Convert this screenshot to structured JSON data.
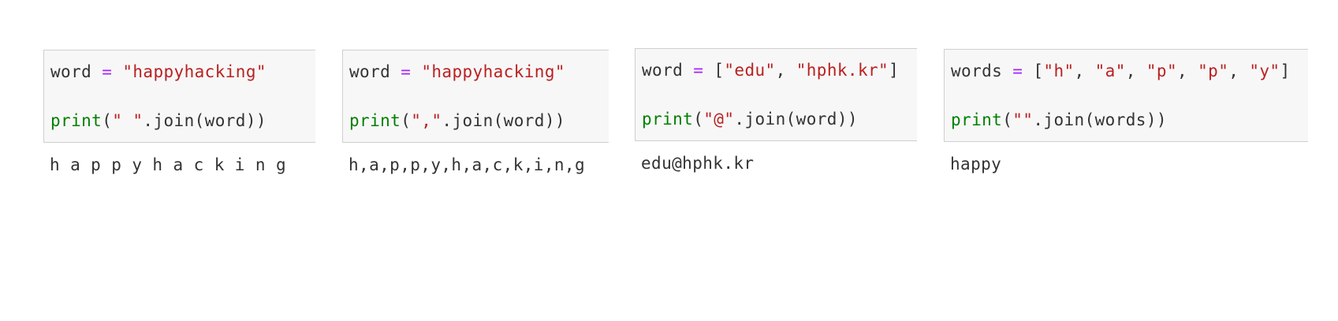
{
  "cells": [
    {
      "line1": [
        {
          "t": "word",
          "k": "name"
        },
        {
          "t": " ",
          "k": "punc"
        },
        {
          "t": "=",
          "k": "op"
        },
        {
          "t": " ",
          "k": "punc"
        },
        {
          "t": "\"happyhacking\"",
          "k": "str"
        }
      ],
      "line2": [
        {
          "t": "print",
          "k": "builtin"
        },
        {
          "t": "(",
          "k": "punc"
        },
        {
          "t": "\" \"",
          "k": "str"
        },
        {
          "t": ".join(word))",
          "k": "punc"
        }
      ],
      "output": "h a p p y h a c k i n g"
    },
    {
      "line1": [
        {
          "t": "word",
          "k": "name"
        },
        {
          "t": " ",
          "k": "punc"
        },
        {
          "t": "=",
          "k": "op"
        },
        {
          "t": " ",
          "k": "punc"
        },
        {
          "t": "\"happyhacking\"",
          "k": "str"
        }
      ],
      "line2": [
        {
          "t": "print",
          "k": "builtin"
        },
        {
          "t": "(",
          "k": "punc"
        },
        {
          "t": "\",\"",
          "k": "str"
        },
        {
          "t": ".join(word))",
          "k": "punc"
        }
      ],
      "output": "h,a,p,p,y,h,a,c,k,i,n,g"
    },
    {
      "line1": [
        {
          "t": "word",
          "k": "name"
        },
        {
          "t": " ",
          "k": "punc"
        },
        {
          "t": "=",
          "k": "op"
        },
        {
          "t": " [",
          "k": "punc"
        },
        {
          "t": "\"edu\"",
          "k": "str"
        },
        {
          "t": ", ",
          "k": "punc"
        },
        {
          "t": "\"hphk.kr\"",
          "k": "str"
        },
        {
          "t": "]",
          "k": "punc"
        }
      ],
      "line2": [
        {
          "t": "print",
          "k": "builtin"
        },
        {
          "t": "(",
          "k": "punc"
        },
        {
          "t": "\"@\"",
          "k": "str"
        },
        {
          "t": ".join(word))",
          "k": "punc"
        }
      ],
      "output": "edu@hphk.kr"
    },
    {
      "line1": [
        {
          "t": "words",
          "k": "name"
        },
        {
          "t": " ",
          "k": "punc"
        },
        {
          "t": "=",
          "k": "op"
        },
        {
          "t": " [",
          "k": "punc"
        },
        {
          "t": "\"h\"",
          "k": "str"
        },
        {
          "t": ", ",
          "k": "punc"
        },
        {
          "t": "\"a\"",
          "k": "str"
        },
        {
          "t": ", ",
          "k": "punc"
        },
        {
          "t": "\"p\"",
          "k": "str"
        },
        {
          "t": ", ",
          "k": "punc"
        },
        {
          "t": "\"p\"",
          "k": "str"
        },
        {
          "t": ", ",
          "k": "punc"
        },
        {
          "t": "\"y\"",
          "k": "str"
        },
        {
          "t": "]",
          "k": "punc"
        }
      ],
      "line2": [
        {
          "t": "print",
          "k": "builtin"
        },
        {
          "t": "(",
          "k": "punc"
        },
        {
          "t": "\"\"",
          "k": "str"
        },
        {
          "t": ".join(words))",
          "k": "punc"
        }
      ],
      "output": "happy"
    }
  ],
  "colors": {
    "name": "#333333",
    "operator": "#aa22ff",
    "string": "#ba2121",
    "builtin": "#008000",
    "code_background": "#f7f7f7",
    "code_border": "#cfcfcf"
  }
}
